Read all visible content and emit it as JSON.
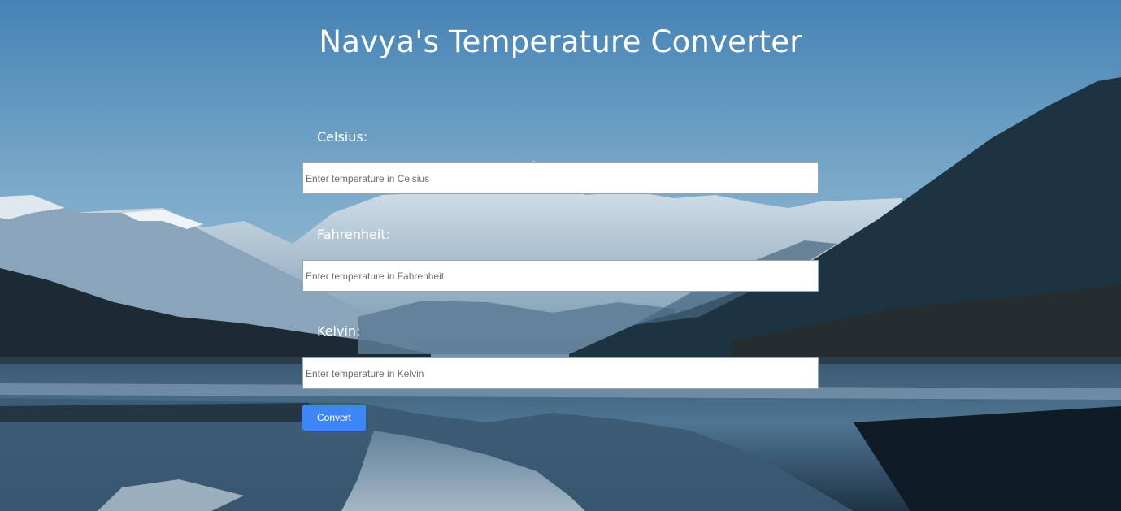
{
  "page": {
    "title": "Navya's Temperature Converter"
  },
  "form": {
    "celsius": {
      "label": "Celsius:",
      "value": "",
      "placeholder": "Enter temperature in Celsius"
    },
    "fahrenheit": {
      "label": "Fahrenheit:",
      "value": "",
      "placeholder": "Enter temperature in Fahrenheit"
    },
    "kelvin": {
      "label": "Kelvin:",
      "value": "",
      "placeholder": "Enter temperature in Kelvin"
    },
    "convert_label": "Convert"
  },
  "colors": {
    "sky_top": "#4a87b8",
    "sky_bottom": "#8fb6cf",
    "button": "#3d86f5"
  }
}
